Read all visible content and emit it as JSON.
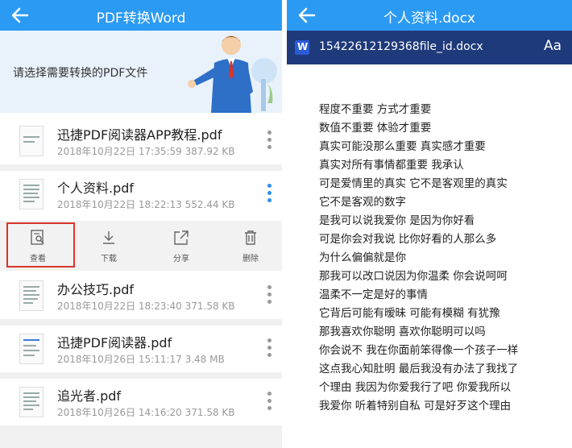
{
  "left": {
    "title": "PDF转换Word",
    "prompt": "请选择需要转换的PDF文件",
    "files": [
      {
        "name": "迅捷PDF阅读器APP教程.pdf",
        "meta": "2018年10月22日 17:35:59   387.92 KB"
      },
      {
        "name": "个人资料.pdf",
        "meta": "2018年10月22日 18:22:13   552.44 KB"
      },
      {
        "name": "办公技巧.pdf",
        "meta": "2018年10月22日 18:23:40   371.58 KB"
      },
      {
        "name": "迅捷PDF阅读器.pdf",
        "meta": "2018年10月26日 15:11:17   3.48 MB"
      },
      {
        "name": "追光者.pdf",
        "meta": "2018年10月26日 14:16:20   371.58 KB"
      }
    ],
    "actions": {
      "view": "查看",
      "download": "下载",
      "share": "分享",
      "delete": "删除"
    },
    "accent": "#2b9af3",
    "highlight_color": "#d9342b"
  },
  "right": {
    "title": "个人资料.docx",
    "filename": "15422612129368file_id.docx",
    "font_button": "Aa",
    "word_icon_letter": "W",
    "lines": [
      "程度不重要 方式才重要",
      "数值不重要 体验才重要",
      "真实可能没那么重要 真实感才重要",
      "真实对所有事情都重要 我承认",
      "可是爱情里的真实 它不是客观里的真实",
      "它不是客观的数字",
      "是我可以说我爱你 是因为你好看",
      "可是你会对我说 比你好看的人那么多",
      "为什么偏偏就是你",
      "那我可以改口说因为你温柔 你会说呵呵",
      "温柔不一定是好的事情",
      "它背后可能有暧昧 可能有模糊 有犹豫",
      "那我喜欢你聪明 喜欢你聪明可以吗",
      "你会说不 我在你面前笨得像一个孩子一样",
      "这点我心知肚明 最后我没有办法了我找了",
      "个理由 我因为你爱我行了吧 你爱我所以",
      "我爱你 听着特别自私 可是好歹这个理由"
    ],
    "bar_color": "#1f3a7a"
  }
}
